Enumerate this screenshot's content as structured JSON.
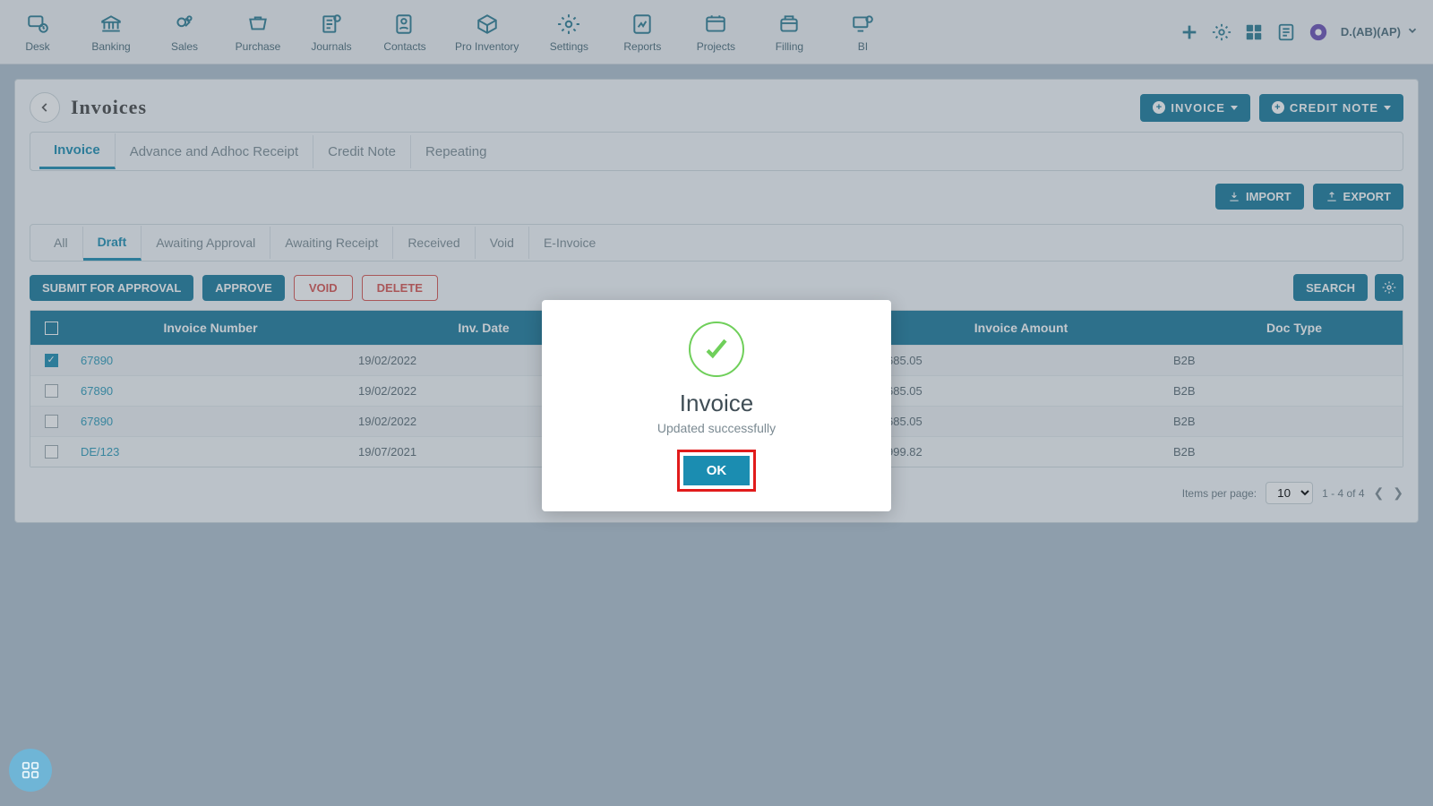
{
  "topnav": {
    "items": [
      {
        "label": "Desk",
        "icon": "desk-icon"
      },
      {
        "label": "Banking",
        "icon": "bank-icon"
      },
      {
        "label": "Sales",
        "icon": "sales-icon"
      },
      {
        "label": "Purchase",
        "icon": "purchase-icon"
      },
      {
        "label": "Journals",
        "icon": "journals-icon"
      },
      {
        "label": "Contacts",
        "icon": "contacts-icon"
      },
      {
        "label": "Pro Inventory",
        "icon": "inventory-icon"
      },
      {
        "label": "Settings",
        "icon": "settings-icon"
      },
      {
        "label": "Reports",
        "icon": "reports-icon"
      },
      {
        "label": "Projects",
        "icon": "projects-icon"
      },
      {
        "label": "Filling",
        "icon": "filling-icon"
      },
      {
        "label": "BI",
        "icon": "bi-icon"
      }
    ],
    "user_label": "D.(AB)(AP)"
  },
  "page": {
    "title": "Invoices",
    "header_buttons": {
      "invoice": "INVOICE",
      "credit_note": "CREDIT NOTE"
    },
    "tabs": [
      "Invoice",
      "Advance and Adhoc Receipt",
      "Credit Note",
      "Repeating"
    ],
    "tabs_active": 0,
    "io_buttons": {
      "import": "IMPORT",
      "export": "EXPORT"
    },
    "subtabs": [
      "All",
      "Draft",
      "Awaiting Approval",
      "Awaiting Receipt",
      "Received",
      "Void",
      "E-Invoice"
    ],
    "subtabs_active": 1,
    "actions": {
      "submit": "SUBMIT FOR APPROVAL",
      "approve": "APPROVE",
      "void": "VOID",
      "delete": "DELETE",
      "search": "SEARCH"
    },
    "columns": [
      "Invoice Number",
      "Inv. Date",
      "",
      "Invoice Amount",
      "Doc Type"
    ],
    "rows": [
      {
        "checked": true,
        "num": "67890",
        "date": "19/02/2022",
        "mid": "",
        "amt": "685.05",
        "doctype": "B2B"
      },
      {
        "checked": false,
        "num": "67890",
        "date": "19/02/2022",
        "mid": "",
        "amt": "685.05",
        "doctype": "B2B"
      },
      {
        "checked": false,
        "num": "67890",
        "date": "19/02/2022",
        "mid": "",
        "amt": "685.05",
        "doctype": "B2B"
      },
      {
        "checked": false,
        "num": "DE/123",
        "date": "19/07/2021",
        "mid": "",
        "amt": "999.82",
        "doctype": "B2B"
      }
    ],
    "pager": {
      "items_per_page_label": "Items per page:",
      "items_per_page": "10",
      "range": "1 - 4 of 4"
    }
  },
  "modal": {
    "title": "Invoice",
    "message": "Updated successfully",
    "ok": "OK"
  }
}
